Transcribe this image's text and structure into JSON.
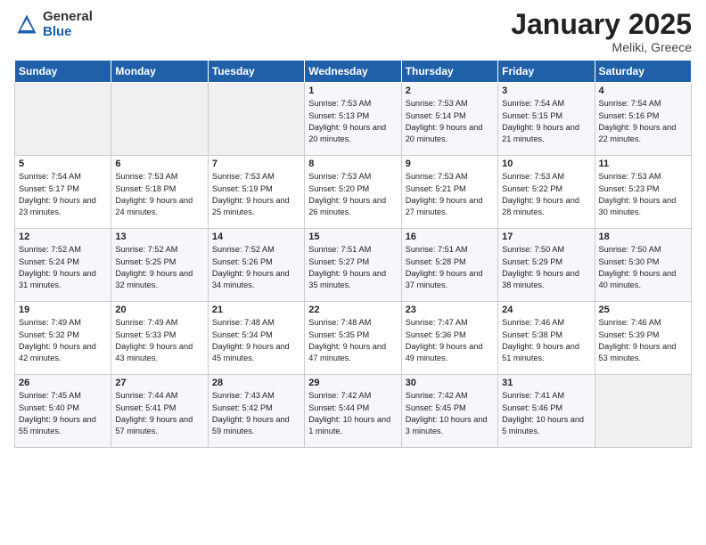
{
  "logo": {
    "general": "General",
    "blue": "Blue"
  },
  "header": {
    "month": "January 2025",
    "location": "Meliki, Greece"
  },
  "weekdays": [
    "Sunday",
    "Monday",
    "Tuesday",
    "Wednesday",
    "Thursday",
    "Friday",
    "Saturday"
  ],
  "weeks": [
    [
      {
        "day": "",
        "info": ""
      },
      {
        "day": "",
        "info": ""
      },
      {
        "day": "",
        "info": ""
      },
      {
        "day": "1",
        "info": "Sunrise: 7:53 AM\nSunset: 5:13 PM\nDaylight: 9 hours and 20 minutes."
      },
      {
        "day": "2",
        "info": "Sunrise: 7:53 AM\nSunset: 5:14 PM\nDaylight: 9 hours and 20 minutes."
      },
      {
        "day": "3",
        "info": "Sunrise: 7:54 AM\nSunset: 5:15 PM\nDaylight: 9 hours and 21 minutes."
      },
      {
        "day": "4",
        "info": "Sunrise: 7:54 AM\nSunset: 5:16 PM\nDaylight: 9 hours and 22 minutes."
      }
    ],
    [
      {
        "day": "5",
        "info": "Sunrise: 7:54 AM\nSunset: 5:17 PM\nDaylight: 9 hours and 23 minutes."
      },
      {
        "day": "6",
        "info": "Sunrise: 7:53 AM\nSunset: 5:18 PM\nDaylight: 9 hours and 24 minutes."
      },
      {
        "day": "7",
        "info": "Sunrise: 7:53 AM\nSunset: 5:19 PM\nDaylight: 9 hours and 25 minutes."
      },
      {
        "day": "8",
        "info": "Sunrise: 7:53 AM\nSunset: 5:20 PM\nDaylight: 9 hours and 26 minutes."
      },
      {
        "day": "9",
        "info": "Sunrise: 7:53 AM\nSunset: 5:21 PM\nDaylight: 9 hours and 27 minutes."
      },
      {
        "day": "10",
        "info": "Sunrise: 7:53 AM\nSunset: 5:22 PM\nDaylight: 9 hours and 28 minutes."
      },
      {
        "day": "11",
        "info": "Sunrise: 7:53 AM\nSunset: 5:23 PM\nDaylight: 9 hours and 30 minutes."
      }
    ],
    [
      {
        "day": "12",
        "info": "Sunrise: 7:52 AM\nSunset: 5:24 PM\nDaylight: 9 hours and 31 minutes."
      },
      {
        "day": "13",
        "info": "Sunrise: 7:52 AM\nSunset: 5:25 PM\nDaylight: 9 hours and 32 minutes."
      },
      {
        "day": "14",
        "info": "Sunrise: 7:52 AM\nSunset: 5:26 PM\nDaylight: 9 hours and 34 minutes."
      },
      {
        "day": "15",
        "info": "Sunrise: 7:51 AM\nSunset: 5:27 PM\nDaylight: 9 hours and 35 minutes."
      },
      {
        "day": "16",
        "info": "Sunrise: 7:51 AM\nSunset: 5:28 PM\nDaylight: 9 hours and 37 minutes."
      },
      {
        "day": "17",
        "info": "Sunrise: 7:50 AM\nSunset: 5:29 PM\nDaylight: 9 hours and 38 minutes."
      },
      {
        "day": "18",
        "info": "Sunrise: 7:50 AM\nSunset: 5:30 PM\nDaylight: 9 hours and 40 minutes."
      }
    ],
    [
      {
        "day": "19",
        "info": "Sunrise: 7:49 AM\nSunset: 5:32 PM\nDaylight: 9 hours and 42 minutes."
      },
      {
        "day": "20",
        "info": "Sunrise: 7:49 AM\nSunset: 5:33 PM\nDaylight: 9 hours and 43 minutes."
      },
      {
        "day": "21",
        "info": "Sunrise: 7:48 AM\nSunset: 5:34 PM\nDaylight: 9 hours and 45 minutes."
      },
      {
        "day": "22",
        "info": "Sunrise: 7:48 AM\nSunset: 5:35 PM\nDaylight: 9 hours and 47 minutes."
      },
      {
        "day": "23",
        "info": "Sunrise: 7:47 AM\nSunset: 5:36 PM\nDaylight: 9 hours and 49 minutes."
      },
      {
        "day": "24",
        "info": "Sunrise: 7:46 AM\nSunset: 5:38 PM\nDaylight: 9 hours and 51 minutes."
      },
      {
        "day": "25",
        "info": "Sunrise: 7:46 AM\nSunset: 5:39 PM\nDaylight: 9 hours and 53 minutes."
      }
    ],
    [
      {
        "day": "26",
        "info": "Sunrise: 7:45 AM\nSunset: 5:40 PM\nDaylight: 9 hours and 55 minutes."
      },
      {
        "day": "27",
        "info": "Sunrise: 7:44 AM\nSunset: 5:41 PM\nDaylight: 9 hours and 57 minutes."
      },
      {
        "day": "28",
        "info": "Sunrise: 7:43 AM\nSunset: 5:42 PM\nDaylight: 9 hours and 59 minutes."
      },
      {
        "day": "29",
        "info": "Sunrise: 7:42 AM\nSunset: 5:44 PM\nDaylight: 10 hours and 1 minute."
      },
      {
        "day": "30",
        "info": "Sunrise: 7:42 AM\nSunset: 5:45 PM\nDaylight: 10 hours and 3 minutes."
      },
      {
        "day": "31",
        "info": "Sunrise: 7:41 AM\nSunset: 5:46 PM\nDaylight: 10 hours and 5 minutes."
      },
      {
        "day": "",
        "info": ""
      }
    ]
  ]
}
